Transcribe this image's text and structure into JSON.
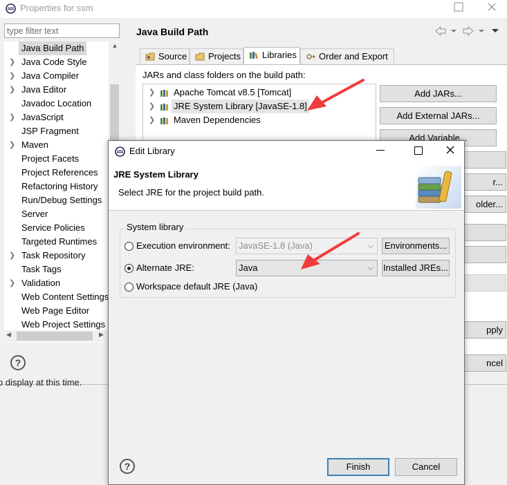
{
  "properties_window": {
    "title": "Properties for ssm",
    "filter_placeholder": "type filter text",
    "tree": [
      {
        "label": "Java Build Path",
        "expandable": false,
        "selected": true
      },
      {
        "label": "Java Code Style",
        "expandable": true
      },
      {
        "label": "Java Compiler",
        "expandable": true
      },
      {
        "label": "Java Editor",
        "expandable": true
      },
      {
        "label": "Javadoc Location",
        "expandable": false
      },
      {
        "label": "JavaScript",
        "expandable": true
      },
      {
        "label": "JSP Fragment",
        "expandable": false
      },
      {
        "label": "Maven",
        "expandable": true
      },
      {
        "label": "Project Facets",
        "expandable": false
      },
      {
        "label": "Project References",
        "expandable": false
      },
      {
        "label": "Refactoring History",
        "expandable": false
      },
      {
        "label": "Run/Debug Settings",
        "expandable": false
      },
      {
        "label": "Server",
        "expandable": false
      },
      {
        "label": "Service Policies",
        "expandable": false
      },
      {
        "label": "Targeted Runtimes",
        "expandable": false
      },
      {
        "label": "Task Repository",
        "expandable": true
      },
      {
        "label": "Task Tags",
        "expandable": false
      },
      {
        "label": "Validation",
        "expandable": true
      },
      {
        "label": "Web Content Settings",
        "expandable": false
      },
      {
        "label": "Web Page Editor",
        "expandable": false
      },
      {
        "label": "Web Project Settings",
        "expandable": false
      }
    ],
    "status_fragment": "o display at this time.",
    "page_title": "Java Build Path",
    "tabs": [
      {
        "label": "Source"
      },
      {
        "label": "Projects"
      },
      {
        "label": "Libraries",
        "active": true
      },
      {
        "label": "Order and Export"
      }
    ],
    "jars_label": "JARs and class folders on the build path:",
    "libraries": [
      {
        "label": "Apache Tomcat v8.5 [Tomcat]"
      },
      {
        "label": "JRE System Library [JavaSE-1.8]",
        "highlighted": true
      },
      {
        "label": "Maven Dependencies"
      }
    ],
    "side_buttons": {
      "add_jars": "Add JARs...",
      "add_external_jars": "Add External JARs...",
      "add_variable": "Add Variable...",
      "frag_r": "r...",
      "frag_older": "older...",
      "frag_apply": "pply",
      "frag_cancel": "ncel"
    }
  },
  "dialog": {
    "title": "Edit Library",
    "heading": "JRE System Library",
    "description": "Select JRE for the project build path.",
    "group_label": "System library",
    "options": {
      "execution_env": {
        "label": "Execution environment:",
        "value": "JavaSE-1.8 (Java)",
        "button": "Environments...",
        "checked": false
      },
      "alternate_jre": {
        "label": "Alternate JRE:",
        "value": "Java",
        "button": "Installed JREs...",
        "checked": true
      },
      "workspace_default": {
        "label": "Workspace default JRE (Java)",
        "checked": false
      }
    },
    "finish_label": "Finish",
    "cancel_label": "Cancel",
    "help_glyph": "?"
  },
  "colors": {
    "annotation_arrow": "#f03c3c",
    "default_button_border": "#3c7fb1"
  }
}
